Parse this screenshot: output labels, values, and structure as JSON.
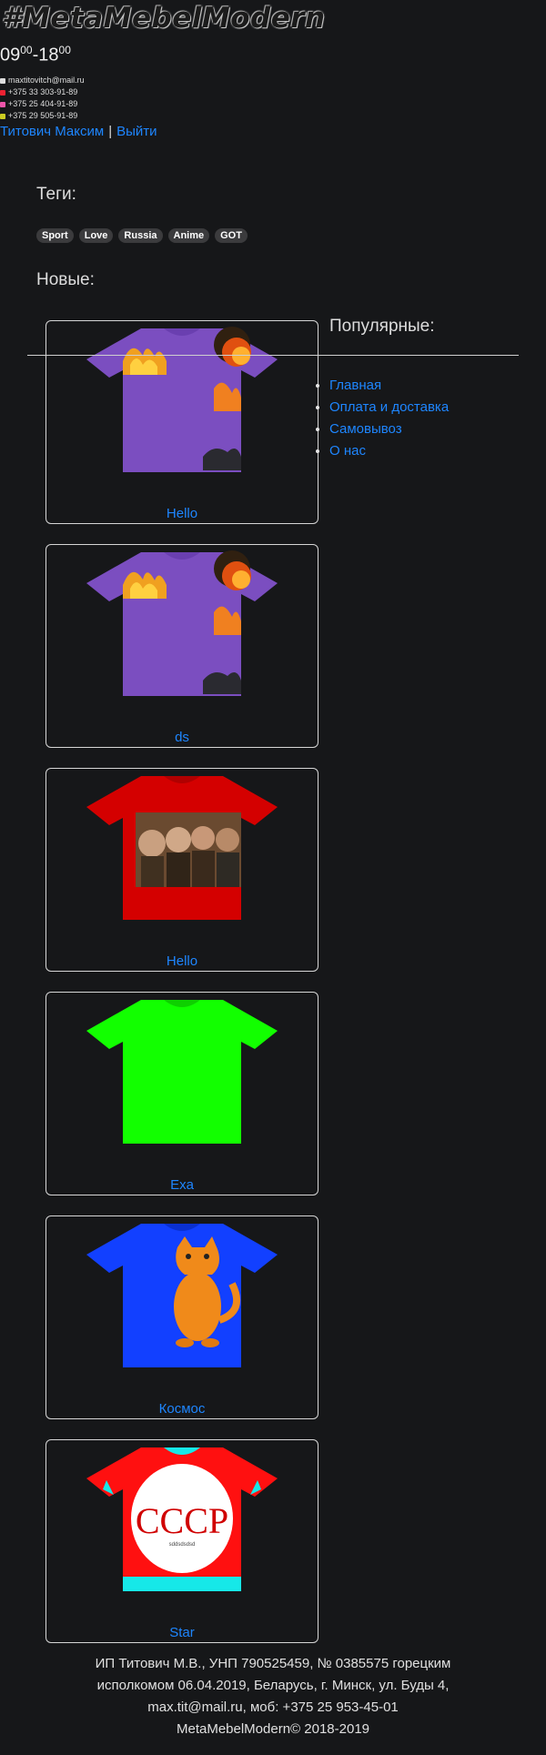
{
  "header": {
    "logo": "#MetaMebelModern",
    "hours_from": "09",
    "hours_from_min": "00",
    "hours_sep": "-",
    "hours_to": "18",
    "hours_to_min": "00",
    "email": "maxtitovitch@mail.ru",
    "phones": [
      "+375 33 303-91-89",
      "+375 25 404-91-89",
      "+375 29 505-91-89"
    ],
    "user_name": "Титович Максим",
    "user_sep": "|",
    "logout": "Выйти"
  },
  "tags": {
    "title": "Теги:",
    "items": [
      "Sport",
      "Love",
      "Russia",
      "Anime",
      "GOT"
    ]
  },
  "new": {
    "title": "Новые:"
  },
  "popular": {
    "title": "Популярные:"
  },
  "menu": [
    "Главная",
    "Оплата и доставка",
    "Самовывоз",
    "О нас"
  ],
  "products": [
    {
      "caption": "Hello",
      "shirt_color": "#7b4ec0",
      "design": "explosion"
    },
    {
      "caption": "ds",
      "shirt_color": "#7b4ec0",
      "design": "explosion"
    },
    {
      "caption": "Hello",
      "shirt_color": "#d40000",
      "design": "portraits"
    },
    {
      "caption": "Exa",
      "shirt_color": "#12ff00",
      "design": "plain"
    },
    {
      "caption": "Космос",
      "shirt_color": "#1240ff",
      "design": "cat"
    },
    {
      "caption": "Star",
      "shirt_color": "#ff1010",
      "design": "cccp",
      "print_text": "CCCP",
      "print_sub": "sddsdsdsd"
    }
  ],
  "footer": {
    "line1": "ИП Титович М.В., УНП 790525459, № 0385575 горецким",
    "line2": "исполкомом 06.04.2019, Беларусь, г. Минск, ул. Буды 4,",
    "line3": "max.tit@mail.ru, моб: +375 25 953-45-01",
    "line4": "MetaMebelModern© 2018-2019"
  },
  "colors": {
    "background": "#161719",
    "link": "#1e86ff"
  }
}
